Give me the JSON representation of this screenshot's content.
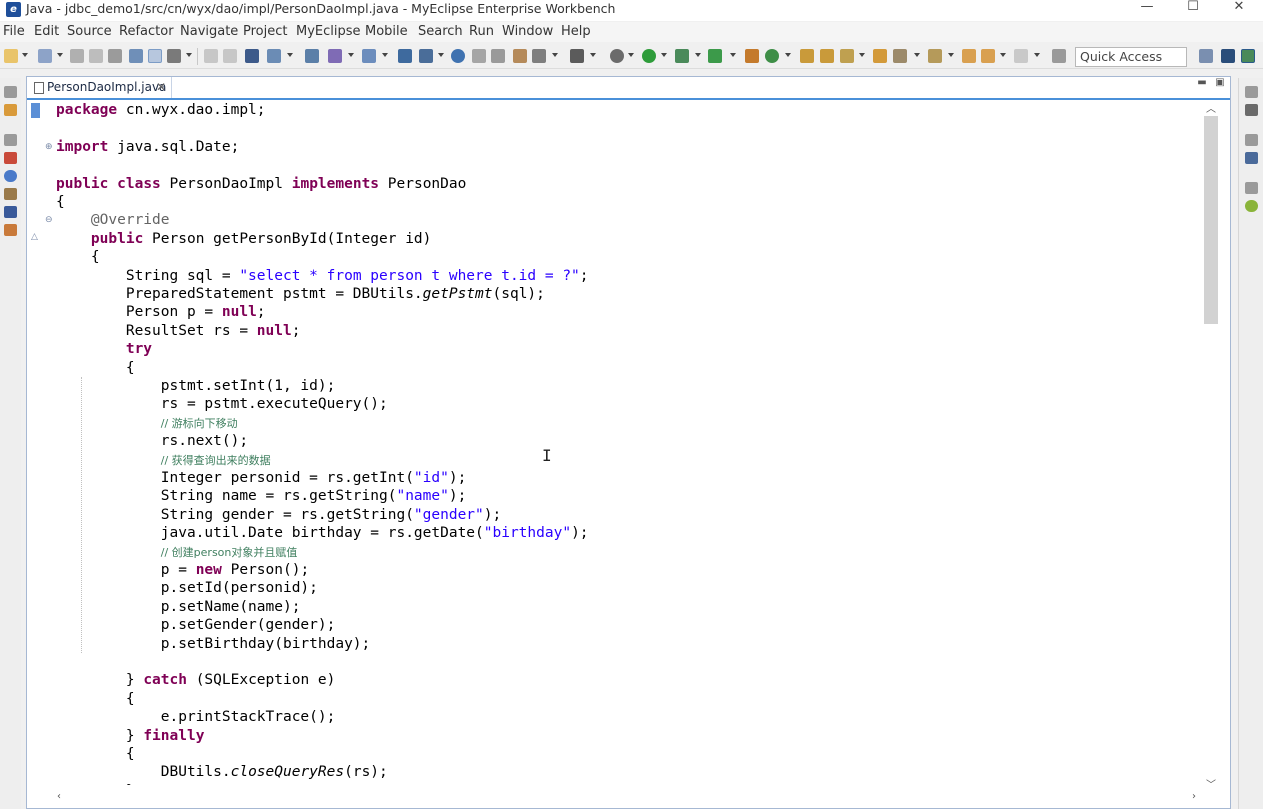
{
  "window": {
    "title": "Java - jdbc_demo1/src/cn/wyx/dao/impl/PersonDaoImpl.java - MyEclipse Enterprise Workbench",
    "controls": {
      "minimize": "—",
      "maximize": "☐",
      "close": "✕"
    }
  },
  "menu": [
    "File",
    "Edit",
    "Source",
    "Refactor",
    "Navigate",
    "Project",
    "MyEclipse",
    "Mobile",
    "Search",
    "Run",
    "Window",
    "Help"
  ],
  "toolbar": {
    "quick_access_placeholder": "Quick Access"
  },
  "editor": {
    "tab_label": "PersonDaoImpl.java",
    "tab_close": "✕",
    "lines": [
      [
        [
          "kw",
          "package"
        ],
        [
          "t",
          " cn.wyx.dao.impl;"
        ]
      ],
      [],
      [
        [
          "kw",
          "import"
        ],
        [
          "t",
          " java.sql.Date;"
        ]
      ],
      [],
      [
        [
          "kw",
          "public"
        ],
        [
          "t",
          " "
        ],
        [
          "kw",
          "class"
        ],
        [
          "t",
          " PersonDaoImpl "
        ],
        [
          "kw",
          "implements"
        ],
        [
          "t",
          " PersonDao"
        ]
      ],
      [
        [
          "t",
          "{"
        ]
      ],
      [
        [
          "ann",
          "    @Override"
        ]
      ],
      [
        [
          "t",
          "    "
        ],
        [
          "kw",
          "public"
        ],
        [
          "t",
          " Person getPersonById(Integer id)"
        ]
      ],
      [
        [
          "t",
          "    {"
        ]
      ],
      [
        [
          "t",
          "        String sql = "
        ],
        [
          "str",
          "\"select * from person t where t.id = ?\""
        ],
        [
          "t",
          ";"
        ]
      ],
      [
        [
          "t",
          "        PreparedStatement pstmt = DBUtils."
        ],
        [
          "it",
          "getPstmt"
        ],
        [
          "t",
          "(sql);"
        ]
      ],
      [
        [
          "t",
          "        Person p = "
        ],
        [
          "kw",
          "null"
        ],
        [
          "t",
          ";"
        ]
      ],
      [
        [
          "t",
          "        ResultSet rs = "
        ],
        [
          "kw",
          "null"
        ],
        [
          "t",
          ";"
        ]
      ],
      [
        [
          "t",
          "        "
        ],
        [
          "kw",
          "try"
        ]
      ],
      [
        [
          "t",
          "        {"
        ]
      ],
      [
        [
          "t",
          "            pstmt.setInt(1, id);"
        ]
      ],
      [
        [
          "t",
          "            rs = pstmt.executeQuery();"
        ]
      ],
      [
        [
          "t",
          "            "
        ],
        [
          "cmt",
          "// 游标向下移动"
        ]
      ],
      [
        [
          "t",
          "            rs.next();"
        ]
      ],
      [
        [
          "t",
          "            "
        ],
        [
          "cmt",
          "// 获得查询出来的数据"
        ]
      ],
      [
        [
          "t",
          "            Integer personid = rs.getInt("
        ],
        [
          "str",
          "\"id\""
        ],
        [
          "t",
          ");"
        ]
      ],
      [
        [
          "t",
          "            String name = rs.getString("
        ],
        [
          "str",
          "\"name\""
        ],
        [
          "t",
          ");"
        ]
      ],
      [
        [
          "t",
          "            String gender = rs.getString("
        ],
        [
          "str",
          "\"gender\""
        ],
        [
          "t",
          ");"
        ]
      ],
      [
        [
          "t",
          "            java.util.Date birthday = rs.getDate("
        ],
        [
          "str",
          "\"birthday\""
        ],
        [
          "t",
          ");"
        ]
      ],
      [
        [
          "t",
          "            "
        ],
        [
          "cmt",
          "// 创建person对象并且赋值"
        ]
      ],
      [
        [
          "t",
          "            p = "
        ],
        [
          "kw",
          "new"
        ],
        [
          "t",
          " Person();"
        ]
      ],
      [
        [
          "t",
          "            p.setId(personid);"
        ]
      ],
      [
        [
          "t",
          "            p.setName(name);"
        ]
      ],
      [
        [
          "t",
          "            p.setGender(gender);"
        ]
      ],
      [
        [
          "t",
          "            p.setBirthday(birthday);"
        ]
      ],
      [],
      [
        [
          "t",
          "        } "
        ],
        [
          "kw",
          "catch"
        ],
        [
          "t",
          " (SQLException e)"
        ]
      ],
      [
        [
          "t",
          "        {"
        ]
      ],
      [
        [
          "t",
          "            e.printStackTrace();"
        ]
      ],
      [
        [
          "t",
          "        } "
        ],
        [
          "kw",
          "finally"
        ]
      ],
      [
        [
          "t",
          "        {"
        ]
      ],
      [
        [
          "t",
          "            DBUtils."
        ],
        [
          "it",
          "closeQueryRes"
        ],
        [
          "t",
          "(rs);"
        ]
      ],
      [
        [
          "t",
          "        }"
        ]
      ]
    ]
  },
  "colors": {
    "keyword": "#7f0055",
    "string": "#2a00ff",
    "comment": "#3f7f5f",
    "annotation": "#646464",
    "editor_border": "#a6b8d3",
    "tab_underline": "#4a90d9"
  },
  "icons": [
    "app-icon",
    "minimize-icon",
    "maximize-icon",
    "close-icon",
    "java-file-icon",
    "fold-icon",
    "scroll-up-icon",
    "scroll-down-icon",
    "scroll-left-icon",
    "scroll-right-icon",
    "text-cursor-icon"
  ]
}
